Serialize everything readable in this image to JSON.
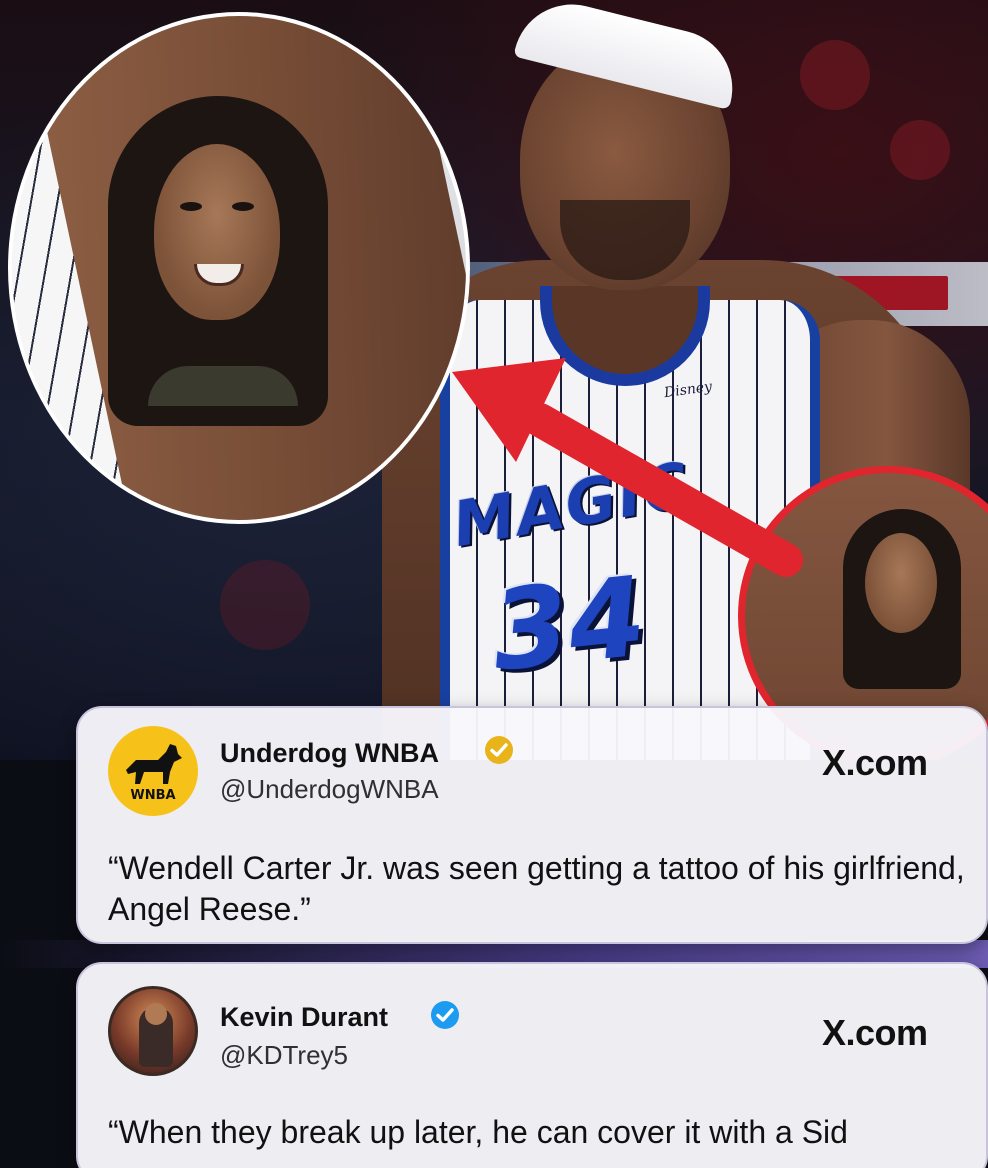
{
  "photo": {
    "jersey_sponsor": "Disney",
    "jersey_team": "MAGIC",
    "jersey_number": "34"
  },
  "tweets": [
    {
      "name": "Underdog WNBA",
      "handle": "@UnderdogWNBA",
      "source": "X.com",
      "avatar_label": "WNBA",
      "verified_color": "#e8b41a",
      "text": "“Wendell Carter Jr. was seen getting a tattoo of his girlfriend, Angel Reese.”"
    },
    {
      "name": "Kevin Durant",
      "handle": "@KDTrey5",
      "source": "X.com",
      "verified_color": "#1d9bf0",
      "text": "“When they break up later, he can cover it with a Sid"
    }
  ],
  "colors": {
    "highlight_red": "#e0252e",
    "magic_blue": "#1e44c0",
    "wnba_yellow": "#f6c21a"
  }
}
